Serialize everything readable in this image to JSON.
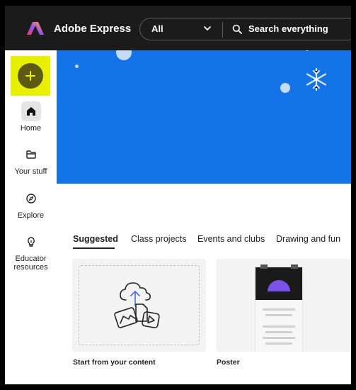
{
  "header": {
    "brand": "Adobe Express",
    "scope": "All",
    "search_placeholder": "Search everything"
  },
  "sidebar": {
    "items": [
      {
        "label": "Home",
        "icon": "home-icon",
        "active": true
      },
      {
        "label": "Your stuff",
        "icon": "folder-icon",
        "active": false
      },
      {
        "label": "Explore",
        "icon": "compass-icon",
        "active": false
      },
      {
        "label": "Educator resources",
        "label_lines": [
          "Educator",
          "resources"
        ],
        "icon": "lightbulb-icon",
        "active": false
      }
    ]
  },
  "tabs": [
    "Suggested",
    "Class projects",
    "Events and clubs",
    "Drawing and fun"
  ],
  "cards": [
    {
      "label": "Start from your content"
    },
    {
      "label": "Poster"
    }
  ],
  "colors": {
    "topbar": "#1b1b1b",
    "hero": "#1473e6",
    "create_highlight": "#e6f000",
    "create_button": "#5d5a13",
    "poster_accent": "#7b52e8"
  }
}
